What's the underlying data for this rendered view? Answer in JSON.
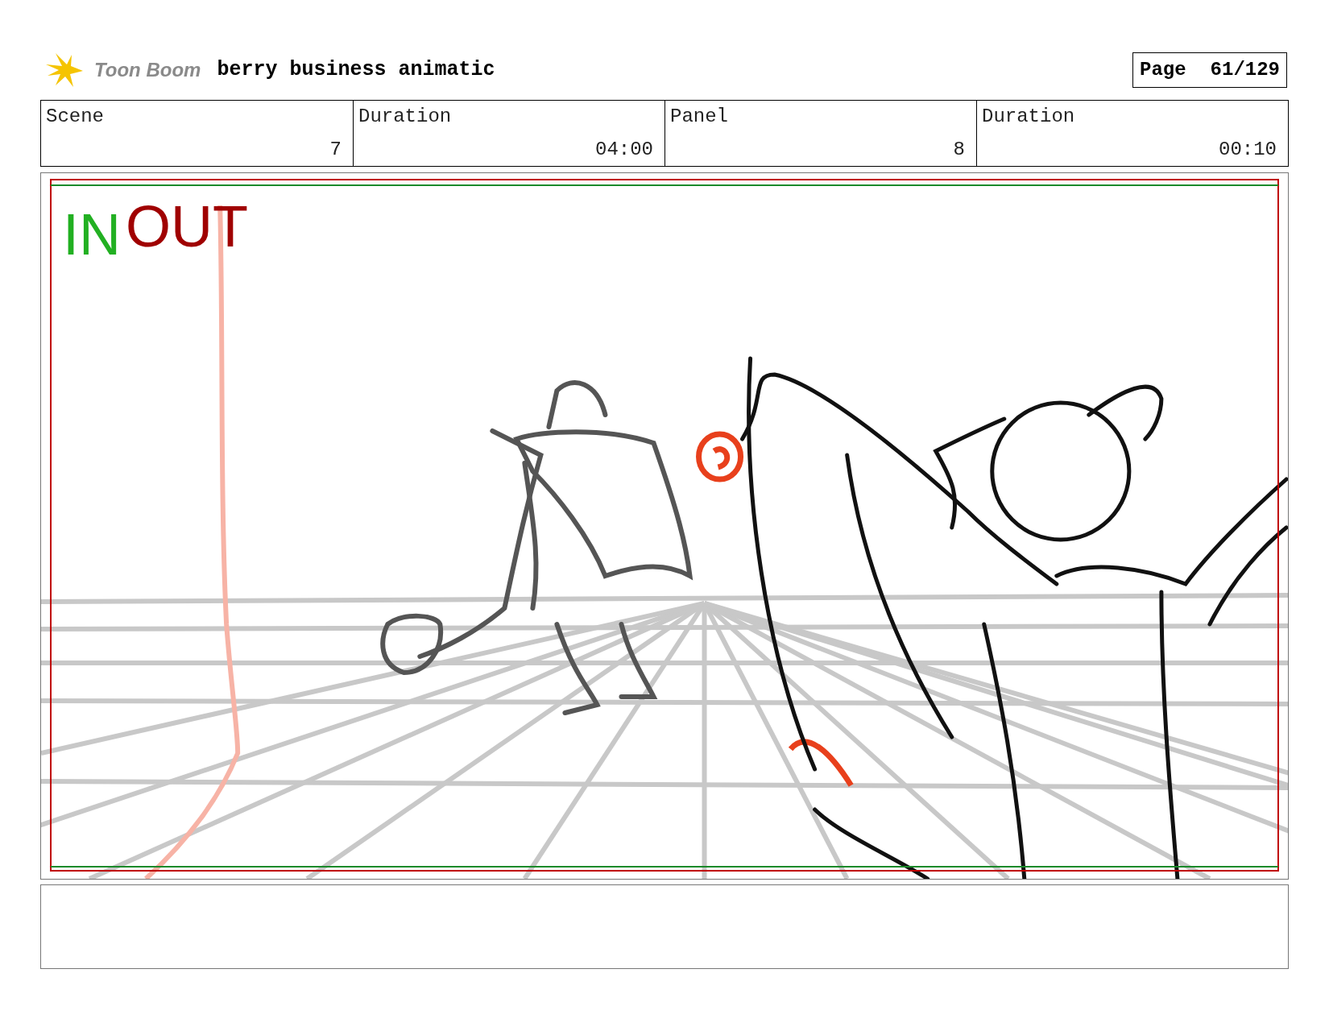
{
  "header": {
    "logo_text": "Toon Boom",
    "title": "berry business animatic",
    "page_label": "Page",
    "page_number": "61/129"
  },
  "info": [
    {
      "label": "Scene",
      "value": "7"
    },
    {
      "label": "Duration",
      "value": "04:00"
    },
    {
      "label": "Panel",
      "value": "8"
    },
    {
      "label": "Duration",
      "value": "00:10"
    }
  ],
  "panel": {
    "marks": [
      {
        "text": "IN",
        "color": "#22b022"
      },
      {
        "text": "OUT",
        "color": "#a00000"
      }
    ]
  }
}
